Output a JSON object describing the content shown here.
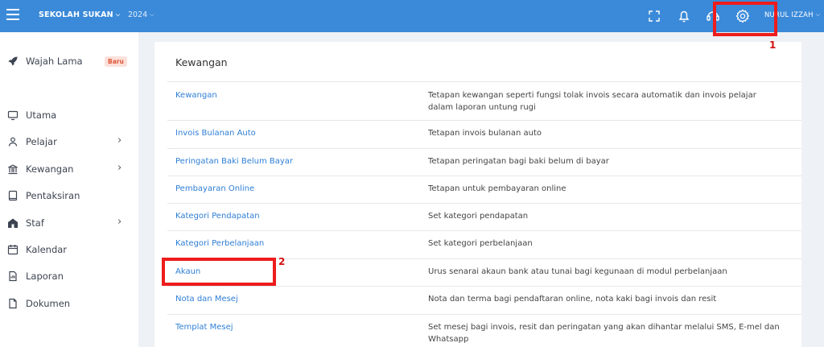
{
  "header": {
    "school": "SEKOLAH SUKAN",
    "year": "2024",
    "user": "NURUL IZZAH",
    "icons": [
      "fullscreen-icon",
      "bell-icon",
      "support-icon",
      "gear-icon",
      "chevron-down-icon"
    ]
  },
  "sidebar": {
    "items": [
      {
        "label": "Wajah Lama",
        "badge": "Baru",
        "icon": "rocket-icon"
      },
      {
        "label": "Utama",
        "icon": "screen-icon"
      },
      {
        "label": "Pelajar",
        "icon": "user-icon",
        "arrow": "›"
      },
      {
        "label": "Kewangan",
        "icon": "bank-icon",
        "arrow": "›"
      },
      {
        "label": "Pentaksiran",
        "icon": "book-icon"
      },
      {
        "label": "Staf",
        "icon": "building-icon",
        "arrow": "›"
      },
      {
        "label": "Kalendar",
        "icon": "calendar-icon"
      },
      {
        "label": "Laporan",
        "icon": "report-icon"
      },
      {
        "label": "Dokumen",
        "icon": "document-icon"
      }
    ]
  },
  "main": {
    "title": "Kewangan",
    "rows": [
      {
        "name": "Kewangan",
        "desc": "Tetapan kewangan seperti fungsi tolak invois secara automatik dan invois pelajar dalam laporan untung rugi"
      },
      {
        "name": "Invois Bulanan Auto",
        "desc": "Tetapan invois bulanan auto"
      },
      {
        "name": "Peringatan Baki Belum Bayar",
        "desc": "Tetapan peringatan bagi baki belum di bayar"
      },
      {
        "name": "Pembayaran Online",
        "desc": "Tetapan untuk pembayaran online"
      },
      {
        "name": "Kategori Pendapatan",
        "desc": "Set kategori pendapatan"
      },
      {
        "name": "Kategori Perbelanjaan",
        "desc": "Set kategori perbelanjaan"
      },
      {
        "name": "Akaun",
        "desc": "Urus senarai akaun bank atau tunai bagi kegunaan di modul perbelanjaan"
      },
      {
        "name": "Nota dan Mesej",
        "desc": "Nota dan terma bagi pendaftaran online, nota kaki bagi invois dan resit"
      },
      {
        "name": "Templat Mesej",
        "desc": "Set mesej bagi invois, resit dan peringatan yang akan dihantar melalui SMS, E-mel dan Whatsapp"
      }
    ]
  },
  "annotations": {
    "step1": "1",
    "step2": "2",
    "color": "#ee1c1c"
  }
}
